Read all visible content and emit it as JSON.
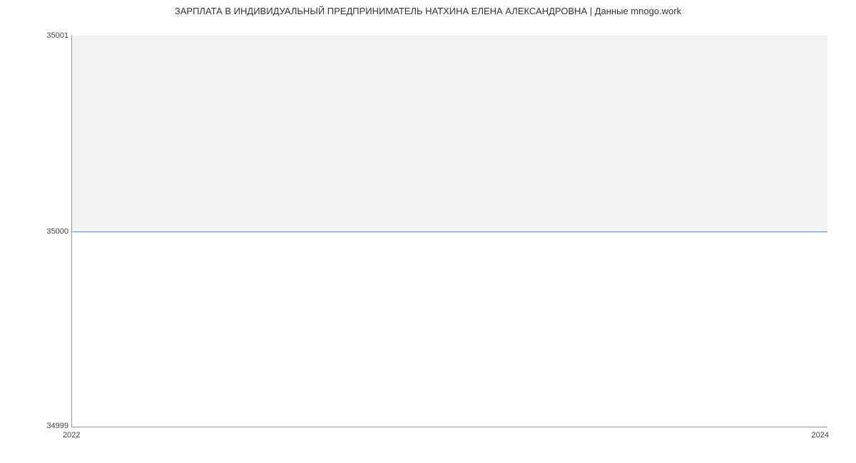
{
  "chart_data": {
    "type": "area",
    "title": "ЗАРПЛАТА В ИНДИВИДУАЛЬНЫЙ ПРЕДПРИНИМАТЕЛЬ НАТХИНА ЕЛЕНА АЛЕКСАНДРОВНА | Данные mnogo.work",
    "x": [
      2022,
      2024
    ],
    "values": [
      35000,
      35000
    ],
    "ylim": [
      34999,
      35001
    ],
    "y_ticks": [
      34999,
      35000,
      35001
    ],
    "x_ticks": [
      2022,
      2024
    ],
    "xlabel": "",
    "ylabel": "",
    "line_color": "#5b8def",
    "fill_color": "#f3f3f3"
  }
}
